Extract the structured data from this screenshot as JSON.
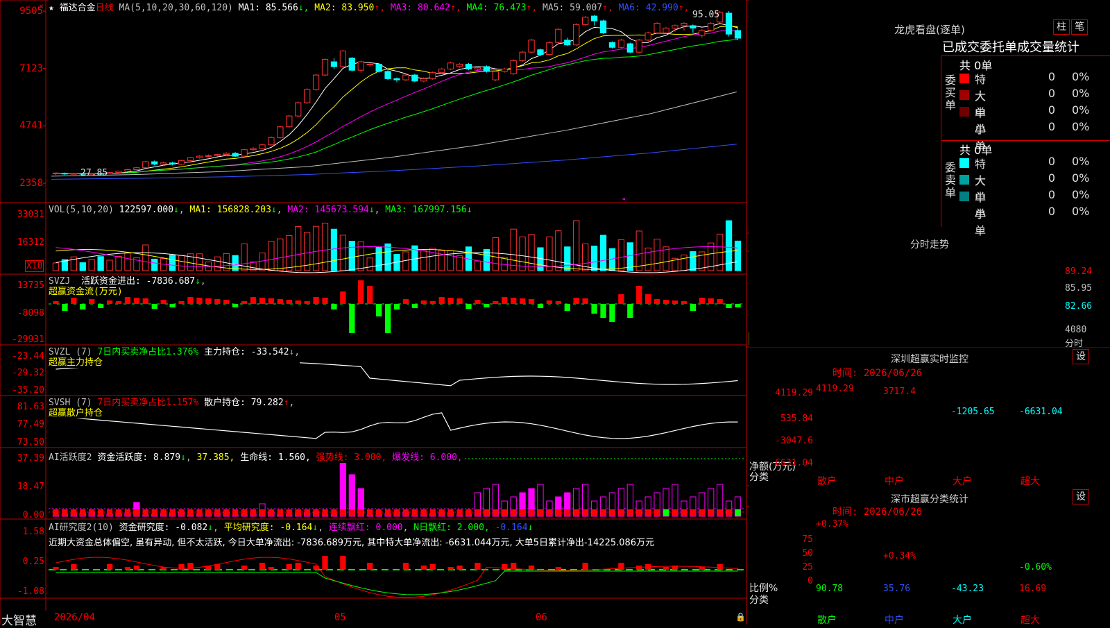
{
  "app": {
    "brand": "大智慧"
  },
  "header": {
    "stock_name": "福达合金",
    "period": "日线",
    "ma_label": "MA(5,10,20,30,60,120)",
    "ma_values": [
      {
        "name": "MA1:",
        "value": "85.566",
        "arrow": "↓",
        "color": "#ffffff"
      },
      {
        "name": "MA2:",
        "value": "83.950",
        "arrow": "↑",
        "color": "#ffff00"
      },
      {
        "name": "MA3:",
        "value": "80.642",
        "arrow": "↑",
        "color": "#ff00ff"
      },
      {
        "name": "MA4:",
        "value": "76.473",
        "arrow": "↑",
        "color": "#00ff00"
      },
      {
        "name": "MA5:",
        "value": "59.007",
        "arrow": "↑",
        "color": "#c0c0c0"
      },
      {
        "name": "MA6:",
        "value": "42.990",
        "arrow": "↑",
        "color": "#3050ff"
      }
    ],
    "high_label": "95.05",
    "low_label": "27.85"
  },
  "main_axis": [
    "9505",
    "7123",
    "4741",
    "2358"
  ],
  "vol_panel": {
    "label": "VOL(5,10,20)",
    "value": "122597.000",
    "arrow": "↓",
    "ma1": "MA1: 156828.203",
    "ma1_arrow": "↓",
    "ma2": "MA2: 145673.594",
    "ma2_arrow": "↓",
    "ma3": "MA3: 167997.156",
    "ma3_arrow": "↓",
    "axis": [
      "33031",
      "16312"
    ],
    "unit": "X10"
  },
  "svzj_panel": {
    "label": "SVZJ",
    "text": "活跃资金进出: -7836.687",
    "arrow": "↓",
    "sub": "超赢资金流(万元)",
    "axis": [
      "13735",
      "-8098",
      "-29931"
    ]
  },
  "svzl_panel": {
    "label": "SVZL (7)",
    "text1": "7日内买卖净占比1.376%",
    "text2": "主力持仓: -33.542",
    "arrow": "↓",
    "sub": "超赢主力持仓",
    "axis": [
      "-23.44",
      "-29.32",
      "-35.20"
    ]
  },
  "svsh_panel": {
    "label": "SVSH (7)",
    "text1": "7日内买卖净占比1.157%",
    "text2": "散户持仓: 79.282",
    "arrow": "↑",
    "sub": "超赢散户持仓",
    "axis": [
      "81.63",
      "77.49",
      "73.50"
    ]
  },
  "ai1_panel": {
    "label": "AI活跃度2",
    "t1": "资金活跃度: 8.879",
    "a1": "↓",
    "t2": "37.385,",
    "t3": "生命线: 1.560,",
    "t4": "强势线: 3.000,",
    "t5": "爆发线: 6.000,",
    "axis": [
      "37.39",
      "18.47",
      "0.00"
    ]
  },
  "ai2_panel": {
    "label": "AI研究度2(10)",
    "t1": "资金研究度: -0.082",
    "a1": "↓",
    "t2": "平均研究度: -0.164",
    "a2": "↓",
    "t3": "连续飘红: 0.000",
    "t4": "N日飘红: 2.000,",
    "t5": "-0.164",
    "a5": "↓",
    "note": "近期大资金总体偏空, 虽有异动, 但不太活跃, 今日大单净流出: -7836.689万元, 其中特大单净流出: -6631.044万元, 大单5日累计净出-14225.086万元",
    "axis": [
      "1.58",
      "0.25",
      "-1.08"
    ]
  },
  "x_axis": {
    "start": "2026/04",
    "m05": "05",
    "m06": "06"
  },
  "lhb": {
    "title": "龙虎看盘(逐单)",
    "btn1": "柱",
    "btn2": "笔",
    "tabs": "已成交委托单成交量统计",
    "buy_total": "共 0单",
    "sell_total": "共 0单",
    "buy_side": "委买单",
    "sell_side": "委卖单",
    "buy_rows": [
      {
        "label": "特大",
        "value": "0",
        "pct": "0%",
        "color": "#ff0000"
      },
      {
        "label": "大单",
        "value": "0",
        "pct": "0%",
        "color": "#a00000"
      },
      {
        "label": "中单",
        "value": "0",
        "pct": "0%",
        "color": "#700000"
      },
      {
        "label": "小单",
        "value": "0",
        "pct": "0%",
        "color": "#000000"
      }
    ],
    "sell_rows": [
      {
        "label": "特大",
        "value": "0",
        "pct": "0%",
        "color": "#00ffff"
      },
      {
        "label": "大单",
        "value": "0",
        "pct": "0%",
        "color": "#00a0a0"
      },
      {
        "label": "中单",
        "value": "0",
        "pct": "0%",
        "color": "#008080"
      },
      {
        "label": "小单",
        "value": "0",
        "pct": "0%",
        "color": "#000000"
      }
    ]
  },
  "intraday": {
    "title": "分时走势",
    "axis": [
      "89.24",
      "85.95",
      "82.66"
    ],
    "vol_label": "4080",
    "time_label": "分时"
  },
  "sz_monitor": {
    "title": "深圳超赢实时监控",
    "btn": "设",
    "time": "时间: 2026/06/26",
    "axis": [
      "4119.29",
      "535.84",
      "-3047.6",
      "-6631.04"
    ],
    "ylabel": "净额(万元)",
    "xlabel": "分类",
    "categories": [
      "散户",
      "中户",
      "大户",
      "超大"
    ],
    "values": [
      "4119.29",
      "3717.4",
      "-1205.65",
      "-6631.04"
    ]
  },
  "sz_class": {
    "title": "深市超赢分类统计",
    "btn": "设",
    "time": "时间: 2026/06/26",
    "axis": [
      "75",
      "50",
      "25",
      "0"
    ],
    "ylabel": "比例%",
    "xlabel": "分类",
    "pct_labels": [
      "+0.37%",
      "+0.34%",
      "",
      "-0.60%"
    ],
    "values": [
      "90.78",
      "35.76",
      "-43.23",
      "16.69"
    ],
    "categories": [
      "散户",
      "中户",
      "大户",
      "超大"
    ]
  },
  "chart_data": {
    "type": "candlestick",
    "title": "福达合金 日线",
    "ylim": [
      2358,
      9505
    ],
    "x_ticks": [
      "2026/04",
      "05",
      "06"
    ],
    "series": [
      {
        "name": "日线",
        "values": [
          [
            2750,
            2780,
            2700,
            2800
          ],
          [
            2770,
            2740,
            2700,
            2800
          ],
          [
            2740,
            2760,
            2720,
            2790
          ],
          [
            2760,
            2740,
            2720,
            2790
          ],
          [
            2740,
            2760,
            2720,
            2780
          ],
          [
            2760,
            2750,
            2720,
            2790
          ],
          [
            2750,
            2800,
            2740,
            2820
          ],
          [
            2800,
            2860,
            2780,
            2880
          ],
          [
            2860,
            2920,
            2840,
            2950
          ],
          [
            2920,
            3000,
            2900,
            3030
          ],
          [
            3000,
            3250,
            2980,
            3280
          ],
          [
            3250,
            3150,
            3100,
            3300
          ],
          [
            3150,
            3200,
            3100,
            3250
          ],
          [
            3200,
            3150,
            3100,
            3250
          ],
          [
            3150,
            3300,
            3120,
            3330
          ],
          [
            3300,
            3420,
            3280,
            3450
          ],
          [
            3420,
            3480,
            3380,
            3520
          ],
          [
            3480,
            3500,
            3440,
            3550
          ],
          [
            3500,
            3550,
            3460,
            3580
          ],
          [
            3550,
            3600,
            3500,
            3640
          ],
          [
            3600,
            3480,
            3450,
            3650
          ],
          [
            3480,
            3750,
            3450,
            3780
          ],
          [
            3750,
            3800,
            3700,
            3850
          ],
          [
            3800,
            3950,
            3780,
            3980
          ],
          [
            3950,
            4250,
            3920,
            4300
          ],
          [
            4250,
            4700,
            4200,
            4750
          ],
          [
            4700,
            5150,
            4650,
            5200
          ],
          [
            5150,
            5700,
            5100,
            5750
          ],
          [
            5700,
            6250,
            5650,
            6300
          ],
          [
            6250,
            6850,
            6200,
            6900
          ],
          [
            6850,
            7500,
            6800,
            7550
          ],
          [
            7400,
            7200,
            7100,
            7550
          ],
          [
            7200,
            7850,
            7150,
            7900
          ],
          [
            7550,
            7050,
            7000,
            7600
          ],
          [
            7050,
            7400,
            6950,
            7450
          ],
          [
            7300,
            7300,
            7200,
            7350
          ],
          [
            7300,
            7000,
            6950,
            7350
          ],
          [
            7000,
            6700,
            6650,
            7050
          ],
          [
            6700,
            6650,
            6550,
            6750
          ],
          [
            6650,
            6850,
            6600,
            6900
          ],
          [
            6850,
            6600,
            6550,
            6900
          ],
          [
            6600,
            6700,
            6550,
            6750
          ],
          [
            6700,
            6950,
            6650,
            7000
          ],
          [
            6950,
            7100,
            6900,
            7150
          ],
          [
            7100,
            7350,
            7050,
            7400
          ],
          [
            7200,
            7300,
            7150,
            7350
          ],
          [
            7300,
            7100,
            7050,
            7350
          ],
          [
            7100,
            7150,
            7050,
            7200
          ],
          [
            7200,
            7000,
            6950,
            7250
          ],
          [
            6650,
            7000,
            6600,
            7050
          ],
          [
            7000,
            7100,
            6950,
            7150
          ],
          [
            6900,
            7450,
            6850,
            7500
          ],
          [
            7450,
            7800,
            7400,
            7850
          ],
          [
            7800,
            8300,
            7750,
            8350
          ],
          [
            7900,
            7700,
            7650,
            7950
          ],
          [
            7700,
            8200,
            7650,
            8250
          ],
          [
            8200,
            8750,
            8150,
            8800
          ],
          [
            8300,
            8100,
            8050,
            8400
          ],
          [
            8100,
            8950,
            8050,
            9000
          ],
          [
            8950,
            9250,
            8900,
            9300
          ],
          [
            9300,
            9100,
            8900,
            9350
          ],
          [
            9100,
            8600,
            8550,
            9150
          ],
          [
            8200,
            8000,
            7950,
            8250
          ],
          [
            8000,
            8300,
            7950,
            8350
          ],
          [
            8150,
            7800,
            7750,
            8200
          ],
          [
            7800,
            8300,
            7750,
            8350
          ],
          [
            8300,
            8600,
            8250,
            8650
          ],
          [
            8600,
            9000,
            8550,
            9050
          ],
          [
            8600,
            8800,
            8550,
            8850
          ],
          [
            8800,
            8900,
            8650,
            8950
          ],
          [
            8900,
            9000,
            8700,
            9050
          ],
          [
            8900,
            8800,
            8600,
            8950
          ],
          [
            8500,
            8700,
            8400,
            8750
          ],
          [
            8700,
            9000,
            8650,
            9050
          ],
          [
            9050,
            9450,
            9000,
            9505
          ],
          [
            9420,
            8550,
            8450,
            9505
          ],
          [
            8700,
            8380,
            8300,
            8800
          ]
        ]
      }
    ]
  }
}
